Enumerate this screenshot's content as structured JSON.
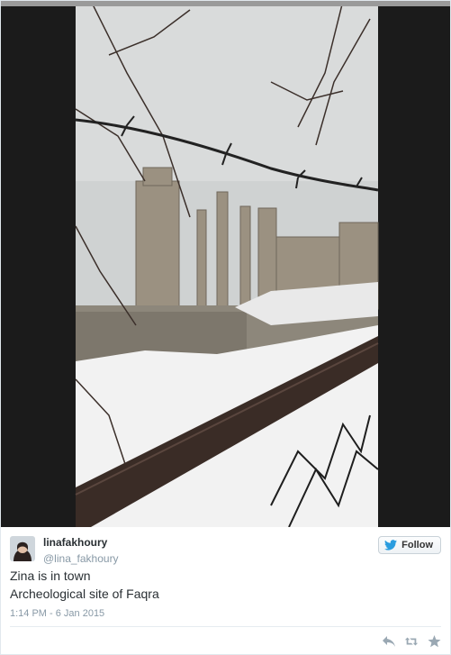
{
  "media": {
    "description_icon": "photo",
    "colors": {
      "sky": "#d9dbdb",
      "snow": "#f2f2f2",
      "stone": "#9b9181",
      "sidebars": "#1b1b1b",
      "rail": "#3a2c26"
    }
  },
  "author": {
    "display_name": "linafakhoury",
    "handle": "@lina_fakhoury"
  },
  "follow_button": {
    "label": "Follow",
    "icon": "twitter-bird-icon"
  },
  "tweet": {
    "lines": [
      "Zina is in town",
      "Archeological site of Faqra"
    ],
    "timestamp": "1:14 PM - 6 Jan 2015"
  },
  "actions": {
    "reply_icon": "reply-icon",
    "retweet_icon": "retweet-icon",
    "favorite_icon": "star-icon"
  }
}
